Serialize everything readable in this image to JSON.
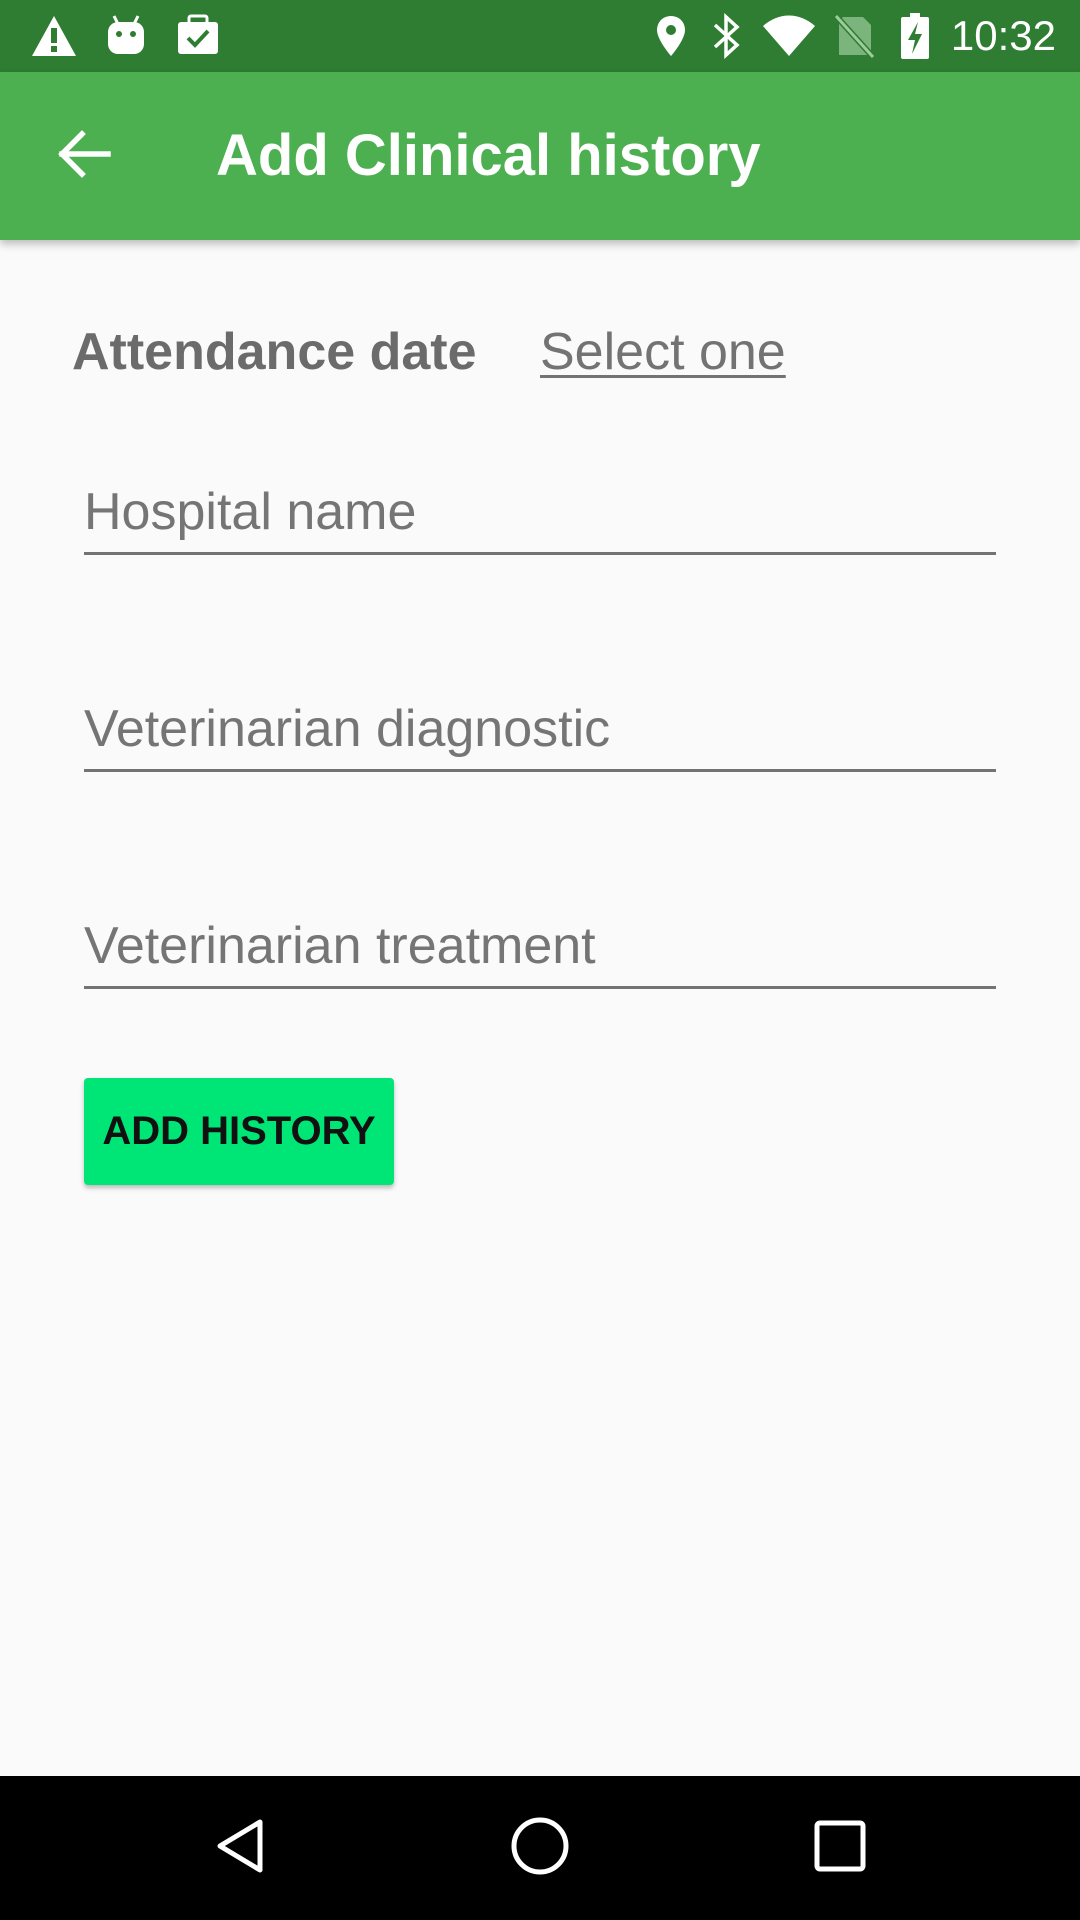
{
  "status_bar": {
    "time": "10:32",
    "left_icons": [
      "warning-icon",
      "android-icon",
      "clipboard-check-icon"
    ],
    "right_icons": [
      "location-pin-icon",
      "bluetooth-icon",
      "wifi-icon",
      "no-sim-icon",
      "battery-charging-icon"
    ]
  },
  "app_bar": {
    "title": "Add Clinical history",
    "back_icon": "arrow-back-icon"
  },
  "form": {
    "attendance_label": "Attendance date",
    "attendance_value": "Select one",
    "hospital_placeholder": "Hospital name",
    "diagnostic_placeholder": "Veterinarian diagnostic",
    "treatment_placeholder": "Veterinarian treatment",
    "submit_label": "ADD HISTORY"
  },
  "colors": {
    "status_bar": "#2e7d32",
    "app_bar": "#4caf50",
    "button": "#00e676",
    "background": "#fafafa"
  },
  "nav_bar": {
    "icons": [
      "nav-back-icon",
      "nav-home-icon",
      "nav-recents-icon"
    ]
  }
}
